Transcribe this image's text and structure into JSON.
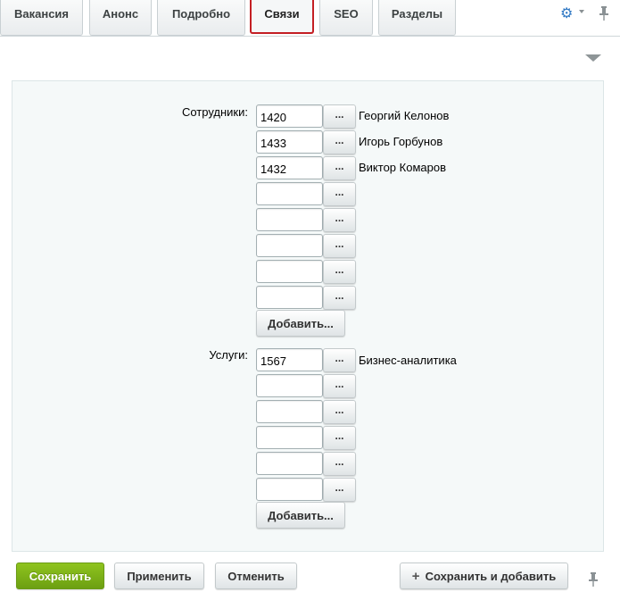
{
  "tabs": [
    {
      "label": "Вакансия"
    },
    {
      "label": "Анонс"
    },
    {
      "label": "Подробно"
    },
    {
      "label": "Связи",
      "active": true
    },
    {
      "label": "SEO"
    },
    {
      "label": "Разделы"
    }
  ],
  "toolbar": {
    "settings_icon": "gear-icon",
    "pin_icon": "pin-icon"
  },
  "employees": {
    "label": "Сотрудники:",
    "rows": [
      {
        "id": "1420",
        "name": "Георгий Келонов"
      },
      {
        "id": "1433",
        "name": "Игорь Горбунов"
      },
      {
        "id": "1432",
        "name": "Виктор Комаров"
      },
      {
        "id": "",
        "name": ""
      },
      {
        "id": "",
        "name": ""
      },
      {
        "id": "",
        "name": ""
      },
      {
        "id": "",
        "name": ""
      },
      {
        "id": "",
        "name": ""
      }
    ],
    "pick_label": "...",
    "add_label": "Добавить..."
  },
  "services": {
    "label": "Услуги:",
    "rows": [
      {
        "id": "1567",
        "name": "Бизнес-аналитика"
      },
      {
        "id": "",
        "name": ""
      },
      {
        "id": "",
        "name": ""
      },
      {
        "id": "",
        "name": ""
      },
      {
        "id": "",
        "name": ""
      },
      {
        "id": "",
        "name": ""
      }
    ],
    "pick_label": "...",
    "add_label": "Добавить..."
  },
  "footer": {
    "save_label": "Сохранить",
    "apply_label": "Применить",
    "cancel_label": "Отменить",
    "save_add_label": "Сохранить и добавить"
  },
  "colors": {
    "accent_green": "#7cb518",
    "active_tab_border": "#c41f24",
    "settings_blue": "#2e77c3"
  }
}
